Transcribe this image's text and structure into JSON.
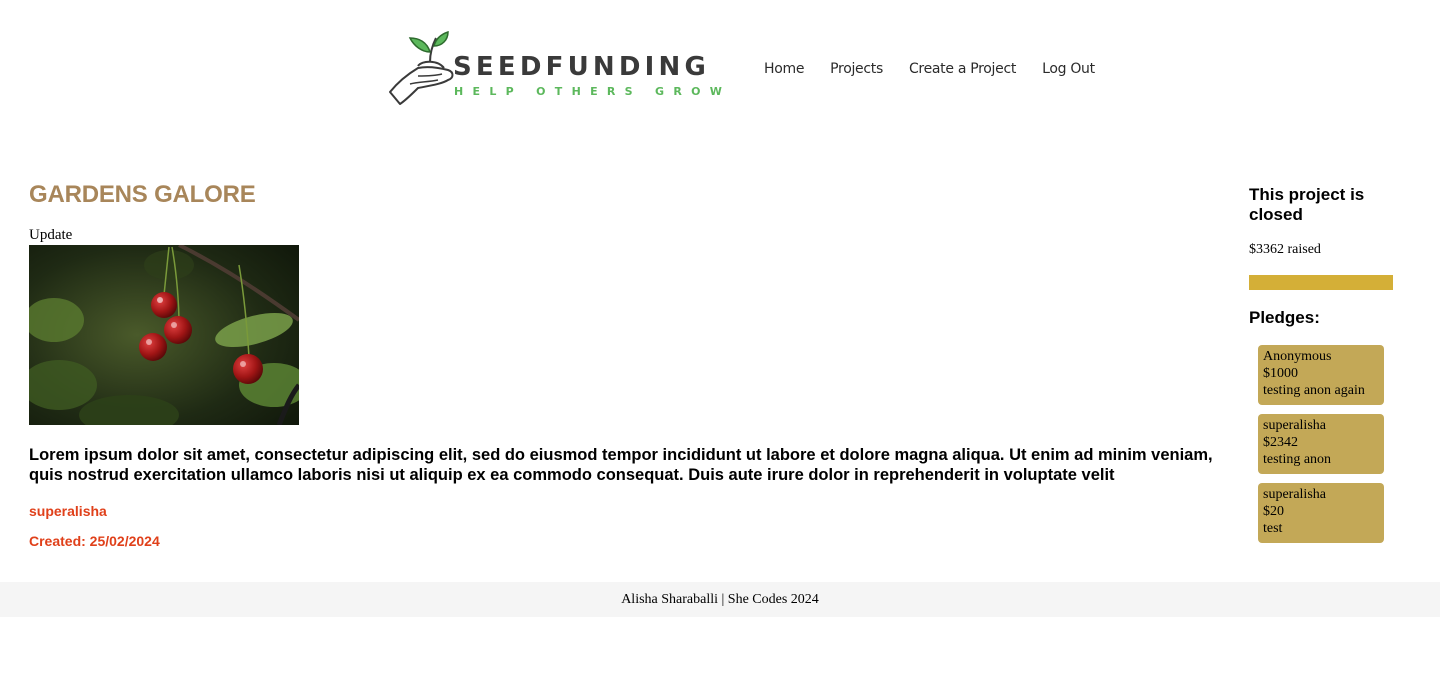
{
  "header": {
    "logo": {
      "title": "SEEDFUNDING",
      "tagline": "HELP OTHERS GROW"
    },
    "nav": [
      {
        "label": "Home"
      },
      {
        "label": "Projects"
      },
      {
        "label": "Create a Project"
      },
      {
        "label": "Log Out"
      }
    ]
  },
  "project": {
    "title": "GARDENS GALORE",
    "update_label": "Update",
    "image_subject": "cherries-on-branch",
    "description": "Lorem ipsum dolor sit amet, consectetur adipiscing elit, sed do eiusmod tempor incididunt ut labore et dolore magna aliqua. Ut enim ad minim veniam, quis nostrud exercitation ullamco laboris nisi ut aliquip ex ea commodo consequat. Duis aute irure dolor in reprehenderit in voluptate velit",
    "owner": "superalisha",
    "created": "Created: 25/02/2024"
  },
  "sidebar": {
    "status": "This project is closed",
    "raised": "$3362 raised",
    "progress_fraction": 1.0,
    "pledges_title": "Pledges:",
    "pledges": [
      {
        "supporter": "Anonymous",
        "amount": "$1000",
        "comment": "testing anon again"
      },
      {
        "supporter": "superalisha",
        "amount": "$2342",
        "comment": "testing anon"
      },
      {
        "supporter": "superalisha",
        "amount": "$20",
        "comment": "test"
      }
    ]
  },
  "footer": {
    "text": "Alisha Sharaballi | She Codes 2024"
  },
  "colors": {
    "title_brown": "#a8865a",
    "accent_orange": "#e0401a",
    "progress_gold": "#d4af37",
    "pledge_bg": "#c3a857",
    "logo_green": "#5cb85c"
  }
}
